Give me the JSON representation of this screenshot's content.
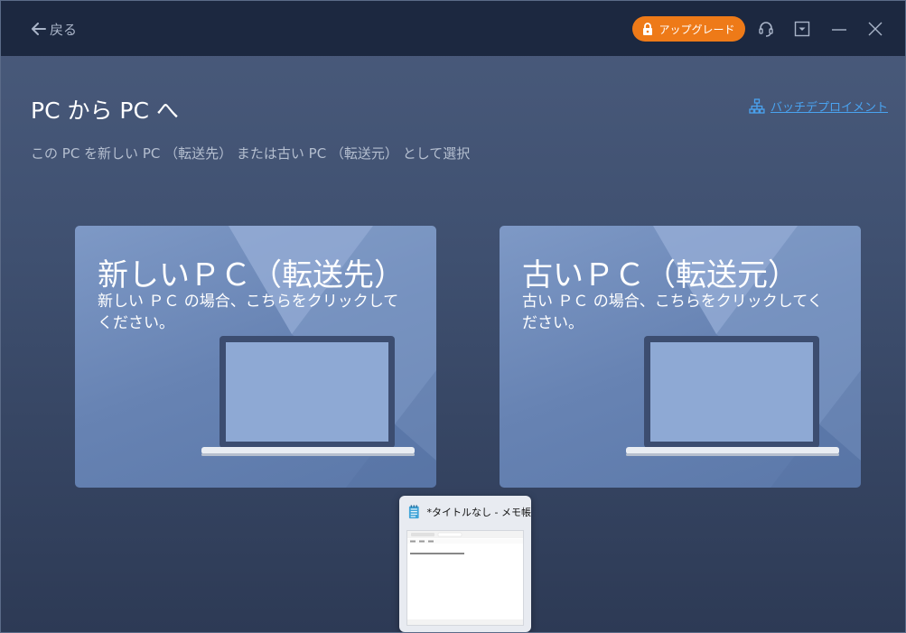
{
  "titlebar": {
    "back_label": "戻る",
    "upgrade_label": "アップグレード"
  },
  "main": {
    "title": "PC から PC へ",
    "batch_link": "バッチデプロイメント",
    "subtitle": "この PC を新しい PC （転送先） または古い PC （転送元） として選択"
  },
  "cards": [
    {
      "title": "新しいＰＣ（転送先）",
      "description": "新しい ＰＣ の場合、こちらをクリックしてください。"
    },
    {
      "title": "古いＰＣ（転送元）",
      "description": "古い ＰＣ の場合、こちらをクリックしてください。"
    }
  ],
  "taskbar_preview": {
    "title": "*タイトルなし - メモ帳"
  },
  "colors": {
    "titlebar_bg": "#1c2840",
    "accent_orange": "#ee7a18",
    "link_blue": "#4aa3f0",
    "card_blue": "#6e89b8"
  }
}
